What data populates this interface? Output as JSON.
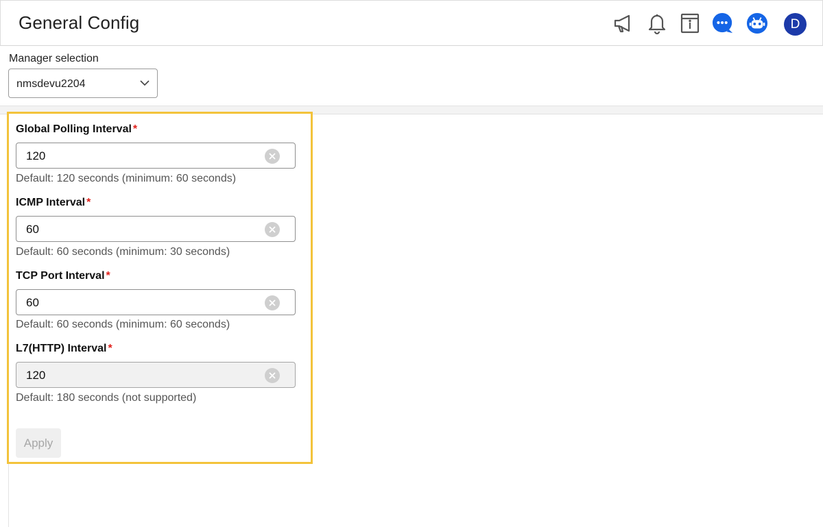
{
  "header": {
    "title": "General Config",
    "icons": [
      "megaphone-icon",
      "bell-icon",
      "info-panel-icon",
      "chat-icon",
      "bot-icon"
    ],
    "avatar_initial": "D",
    "colors": {
      "accent": "#1565e6",
      "avatar": "#1c3aa9"
    }
  },
  "manager": {
    "label": "Manager selection",
    "selected": "nmsdevu2204"
  },
  "form": {
    "fields": [
      {
        "label": "Global Polling Interval",
        "required": "*",
        "value": "120",
        "helper": "Default: 120 seconds (minimum: 60 seconds)",
        "disabled": false
      },
      {
        "label": "ICMP Interval",
        "required": "*",
        "value": "60",
        "helper": "Default: 60 seconds (minimum: 30 seconds)",
        "disabled": false
      },
      {
        "label": "TCP Port Interval",
        "required": "*",
        "value": "60",
        "helper": "Default: 60 seconds (minimum: 60 seconds)",
        "disabled": false
      },
      {
        "label": "L7(HTTP) Interval",
        "required": "*",
        "value": "120",
        "helper": "Default: 180 seconds (not supported)",
        "disabled": true
      }
    ],
    "apply_label": "Apply",
    "colors": {
      "highlight_border": "#f3c33b",
      "required_marker": "#e0201b"
    }
  }
}
